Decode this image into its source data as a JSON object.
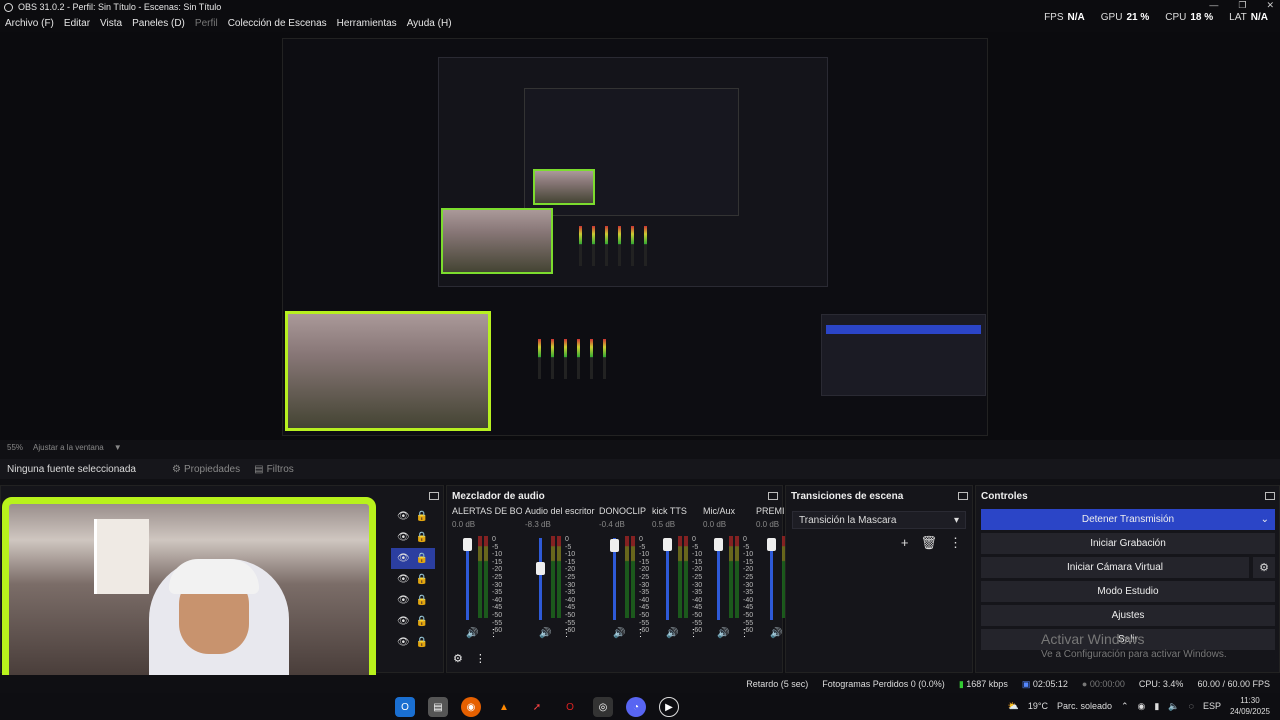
{
  "window": {
    "title": "OBS 31.0.2 - Perfil: Sin Título - Escenas: Sin Título",
    "controls": [
      "—",
      "❐",
      "✕"
    ]
  },
  "menu": [
    "Archivo (F)",
    "Editar",
    "Vista",
    "Paneles (D)",
    "Perfil",
    "Colección de Escenas",
    "Herramientas",
    "Ayuda (H)"
  ],
  "stats": [
    {
      "label": "FPS",
      "value": "N/A"
    },
    {
      "label": "GPU",
      "value": "21 %"
    },
    {
      "label": "CPU",
      "value": "18 %"
    },
    {
      "label": "LAT",
      "value": "N/A"
    }
  ],
  "zoom": {
    "percent": "55%",
    "label": "Ajustar a la ventana"
  },
  "source_bar": {
    "status": "Ninguna fuente seleccionada",
    "properties": "Propiedades",
    "filters": "Filtros"
  },
  "mixer": {
    "title": "Mezclador de audio",
    "channels": [
      {
        "name": "ALERTAS DE BOT",
        "db": "0.0 dB",
        "fader": 0.0
      },
      {
        "name": "Audio del escritorio",
        "db": "-8.3 dB",
        "fader": 0.35
      },
      {
        "name": "DONOCLIP",
        "db": "-0.4 dB",
        "fader": 0.02
      },
      {
        "name": "kick  TTS",
        "db": "0.5 dB",
        "fader": 0.0
      },
      {
        "name": "Mic/Aux",
        "db": "0.0 dB",
        "fader": 0.0
      },
      {
        "name": "PREMI",
        "db": "0.0 dB",
        "fader": 0.0
      }
    ],
    "scale": [
      "0",
      "-5",
      "-10",
      "-15",
      "-20",
      "-25",
      "-30",
      "-35",
      "-40",
      "-45",
      "-50",
      "-55",
      "-60"
    ]
  },
  "transitions": {
    "title": "Transiciones de escena",
    "selected": "Transición la Mascara"
  },
  "controls": {
    "title": "Controles",
    "buttons": [
      "Detener Transmisión",
      "Iniciar Grabación",
      "Iniciar Cámara Virtual",
      "Modo Estudio",
      "Ajustes",
      "Salir"
    ]
  },
  "watermark": {
    "title": "Activar Windows",
    "subtitle": "Ve a Configuración para activar Windows."
  },
  "status": {
    "delay": "Retardo (5 sec)",
    "dropped": "Fotogramas Perdidos 0 (0.0%)",
    "bitrate": "1687 kbps",
    "stream_time": "02:05:12",
    "rec_time": "00:00:00",
    "cpu": "CPU: 3.4%",
    "fps": "60.00 / 60.00 FPS"
  },
  "taskbar": {
    "weather_temp": "19°C",
    "weather_desc": "Parc. soleado",
    "lang": "ESP",
    "time": "11:30",
    "date": "24/09/2025"
  },
  "colors": {
    "accent": "#2b45c7",
    "webcam_border": "#b8f21c",
    "meter_green": "#1d6a1d"
  }
}
